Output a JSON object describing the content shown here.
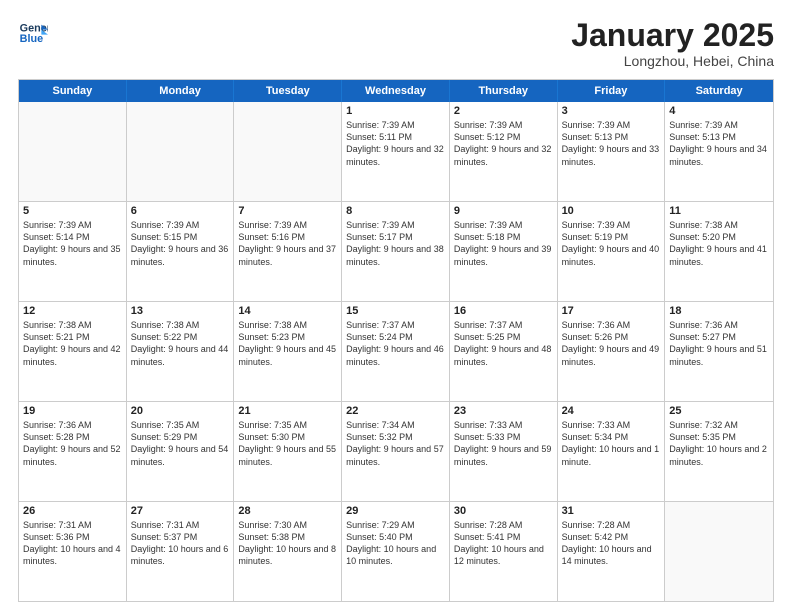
{
  "logo": {
    "line1": "General",
    "line2": "Blue"
  },
  "title": "January 2025",
  "location": "Longzhou, Hebei, China",
  "weekdays": [
    "Sunday",
    "Monday",
    "Tuesday",
    "Wednesday",
    "Thursday",
    "Friday",
    "Saturday"
  ],
  "weeks": [
    [
      {
        "day": "",
        "info": ""
      },
      {
        "day": "",
        "info": ""
      },
      {
        "day": "",
        "info": ""
      },
      {
        "day": "1",
        "info": "Sunrise: 7:39 AM\nSunset: 5:11 PM\nDaylight: 9 hours\nand 32 minutes."
      },
      {
        "day": "2",
        "info": "Sunrise: 7:39 AM\nSunset: 5:12 PM\nDaylight: 9 hours\nand 32 minutes."
      },
      {
        "day": "3",
        "info": "Sunrise: 7:39 AM\nSunset: 5:13 PM\nDaylight: 9 hours\nand 33 minutes."
      },
      {
        "day": "4",
        "info": "Sunrise: 7:39 AM\nSunset: 5:13 PM\nDaylight: 9 hours\nand 34 minutes."
      }
    ],
    [
      {
        "day": "5",
        "info": "Sunrise: 7:39 AM\nSunset: 5:14 PM\nDaylight: 9 hours\nand 35 minutes."
      },
      {
        "day": "6",
        "info": "Sunrise: 7:39 AM\nSunset: 5:15 PM\nDaylight: 9 hours\nand 36 minutes."
      },
      {
        "day": "7",
        "info": "Sunrise: 7:39 AM\nSunset: 5:16 PM\nDaylight: 9 hours\nand 37 minutes."
      },
      {
        "day": "8",
        "info": "Sunrise: 7:39 AM\nSunset: 5:17 PM\nDaylight: 9 hours\nand 38 minutes."
      },
      {
        "day": "9",
        "info": "Sunrise: 7:39 AM\nSunset: 5:18 PM\nDaylight: 9 hours\nand 39 minutes."
      },
      {
        "day": "10",
        "info": "Sunrise: 7:39 AM\nSunset: 5:19 PM\nDaylight: 9 hours\nand 40 minutes."
      },
      {
        "day": "11",
        "info": "Sunrise: 7:38 AM\nSunset: 5:20 PM\nDaylight: 9 hours\nand 41 minutes."
      }
    ],
    [
      {
        "day": "12",
        "info": "Sunrise: 7:38 AM\nSunset: 5:21 PM\nDaylight: 9 hours\nand 42 minutes."
      },
      {
        "day": "13",
        "info": "Sunrise: 7:38 AM\nSunset: 5:22 PM\nDaylight: 9 hours\nand 44 minutes."
      },
      {
        "day": "14",
        "info": "Sunrise: 7:38 AM\nSunset: 5:23 PM\nDaylight: 9 hours\nand 45 minutes."
      },
      {
        "day": "15",
        "info": "Sunrise: 7:37 AM\nSunset: 5:24 PM\nDaylight: 9 hours\nand 46 minutes."
      },
      {
        "day": "16",
        "info": "Sunrise: 7:37 AM\nSunset: 5:25 PM\nDaylight: 9 hours\nand 48 minutes."
      },
      {
        "day": "17",
        "info": "Sunrise: 7:36 AM\nSunset: 5:26 PM\nDaylight: 9 hours\nand 49 minutes."
      },
      {
        "day": "18",
        "info": "Sunrise: 7:36 AM\nSunset: 5:27 PM\nDaylight: 9 hours\nand 51 minutes."
      }
    ],
    [
      {
        "day": "19",
        "info": "Sunrise: 7:36 AM\nSunset: 5:28 PM\nDaylight: 9 hours\nand 52 minutes."
      },
      {
        "day": "20",
        "info": "Sunrise: 7:35 AM\nSunset: 5:29 PM\nDaylight: 9 hours\nand 54 minutes."
      },
      {
        "day": "21",
        "info": "Sunrise: 7:35 AM\nSunset: 5:30 PM\nDaylight: 9 hours\nand 55 minutes."
      },
      {
        "day": "22",
        "info": "Sunrise: 7:34 AM\nSunset: 5:32 PM\nDaylight: 9 hours\nand 57 minutes."
      },
      {
        "day": "23",
        "info": "Sunrise: 7:33 AM\nSunset: 5:33 PM\nDaylight: 9 hours\nand 59 minutes."
      },
      {
        "day": "24",
        "info": "Sunrise: 7:33 AM\nSunset: 5:34 PM\nDaylight: 10 hours\nand 1 minute."
      },
      {
        "day": "25",
        "info": "Sunrise: 7:32 AM\nSunset: 5:35 PM\nDaylight: 10 hours\nand 2 minutes."
      }
    ],
    [
      {
        "day": "26",
        "info": "Sunrise: 7:31 AM\nSunset: 5:36 PM\nDaylight: 10 hours\nand 4 minutes."
      },
      {
        "day": "27",
        "info": "Sunrise: 7:31 AM\nSunset: 5:37 PM\nDaylight: 10 hours\nand 6 minutes."
      },
      {
        "day": "28",
        "info": "Sunrise: 7:30 AM\nSunset: 5:38 PM\nDaylight: 10 hours\nand 8 minutes."
      },
      {
        "day": "29",
        "info": "Sunrise: 7:29 AM\nSunset: 5:40 PM\nDaylight: 10 hours\nand 10 minutes."
      },
      {
        "day": "30",
        "info": "Sunrise: 7:28 AM\nSunset: 5:41 PM\nDaylight: 10 hours\nand 12 minutes."
      },
      {
        "day": "31",
        "info": "Sunrise: 7:28 AM\nSunset: 5:42 PM\nDaylight: 10 hours\nand 14 minutes."
      },
      {
        "day": "",
        "info": ""
      }
    ]
  ]
}
